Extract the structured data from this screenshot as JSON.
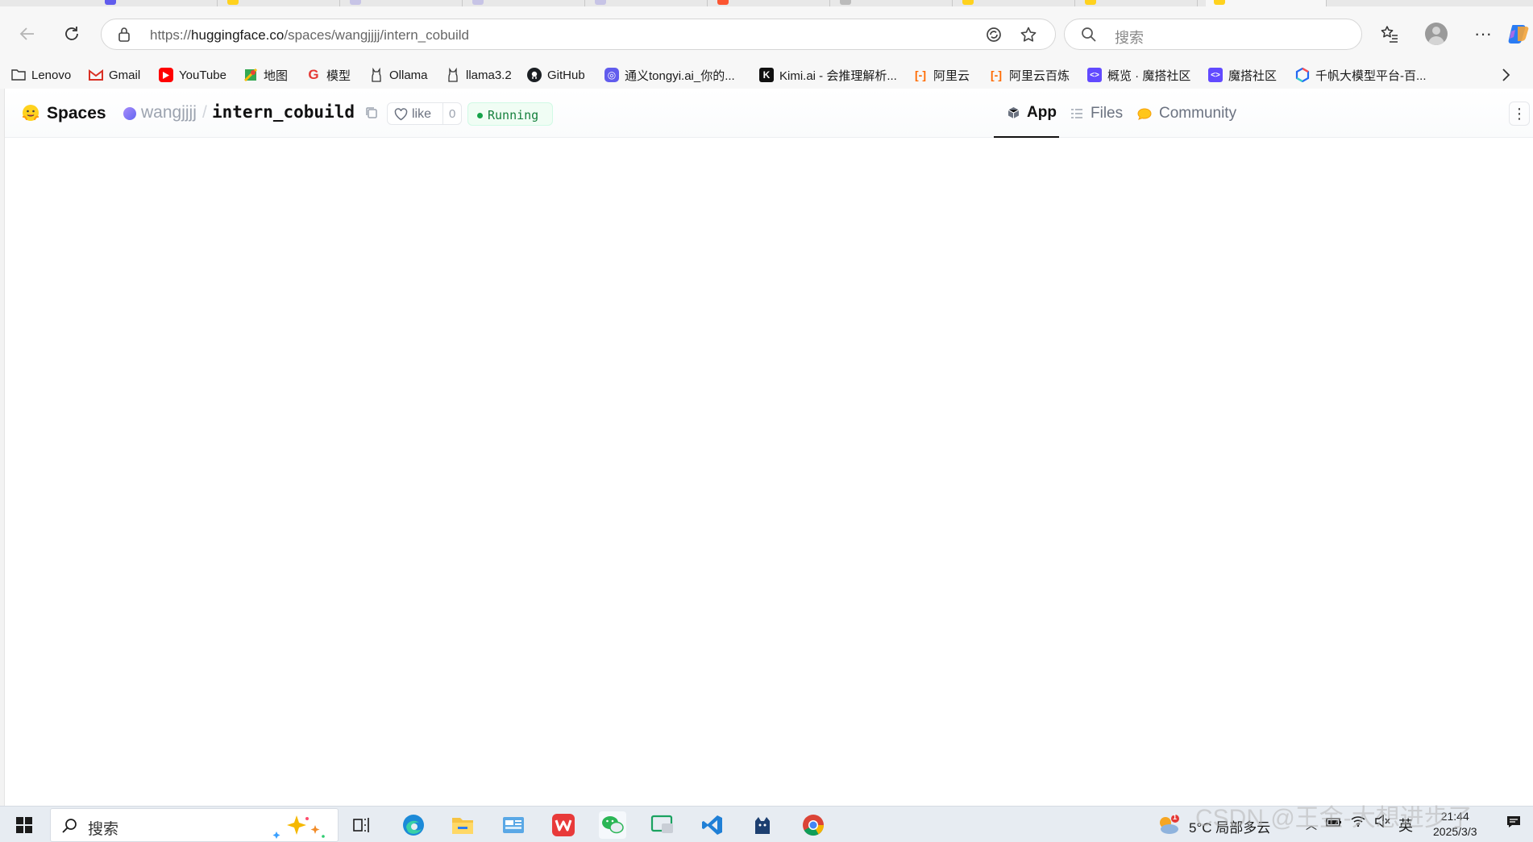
{
  "browser": {
    "url_prefix": "https://",
    "url_domain": "huggingface.co",
    "url_path": "/spaces/wangjjjj/intern_cobuild",
    "search_placeholder": "搜索"
  },
  "bookmarks": [
    {
      "label": "Lenovo",
      "icon": "folder-icon",
      "color": "#333333"
    },
    {
      "label": "Gmail",
      "icon": "gmail-icon",
      "color": "#d93025"
    },
    {
      "label": "YouTube",
      "icon": "youtube-icon",
      "color": "#ff0000"
    },
    {
      "label": "地图",
      "icon": "maps-icon",
      "color": "#34a853"
    },
    {
      "label": "模型",
      "icon": "g-icon",
      "color": "#e53935"
    },
    {
      "label": "Ollama",
      "icon": "ollama-icon",
      "color": "#333333"
    },
    {
      "label": "llama3.2",
      "icon": "ollama-icon",
      "color": "#333333"
    },
    {
      "label": "GitHub",
      "icon": "github-icon",
      "color": "#1b1f23"
    },
    {
      "label": "通义tongyi.ai_你的...",
      "icon": "tongyi-icon",
      "color": "#615ced"
    },
    {
      "label": "Kimi.ai - 会推理解析...",
      "icon": "kimi-icon",
      "color": "#111111"
    },
    {
      "label": "阿里云",
      "icon": "aliyun-icon",
      "color": "#ff6a00"
    },
    {
      "label": "阿里云百炼",
      "icon": "aliyun-icon",
      "color": "#ff6a00"
    },
    {
      "label": "概览 · 魔搭社区",
      "icon": "modelscope-icon",
      "color": "#624aff"
    },
    {
      "label": "魔搭社区",
      "icon": "modelscope-icon",
      "color": "#624aff"
    },
    {
      "label": "千帆大模型平台-百...",
      "icon": "qianfan-icon",
      "color": "#2468f2"
    }
  ],
  "space": {
    "brand": "Spaces",
    "owner": "wangjjjj",
    "separator": "/",
    "repo": "intern_cobuild",
    "like_label": "like",
    "like_count": "0",
    "status": "Running",
    "tabs": [
      {
        "label": "App",
        "icon": "app-cube-icon",
        "active": true
      },
      {
        "label": "Files",
        "icon": "files-icon",
        "active": false
      },
      {
        "label": "Community",
        "icon": "community-icon",
        "active": false
      }
    ]
  },
  "taskbar": {
    "search_placeholder": "搜索",
    "weather": "5°C  局部多云",
    "ime": "英",
    "time": "21:44",
    "date": "2025/3/3",
    "notification_count": "1"
  },
  "watermark": "CSDN @王金-大想进步了"
}
